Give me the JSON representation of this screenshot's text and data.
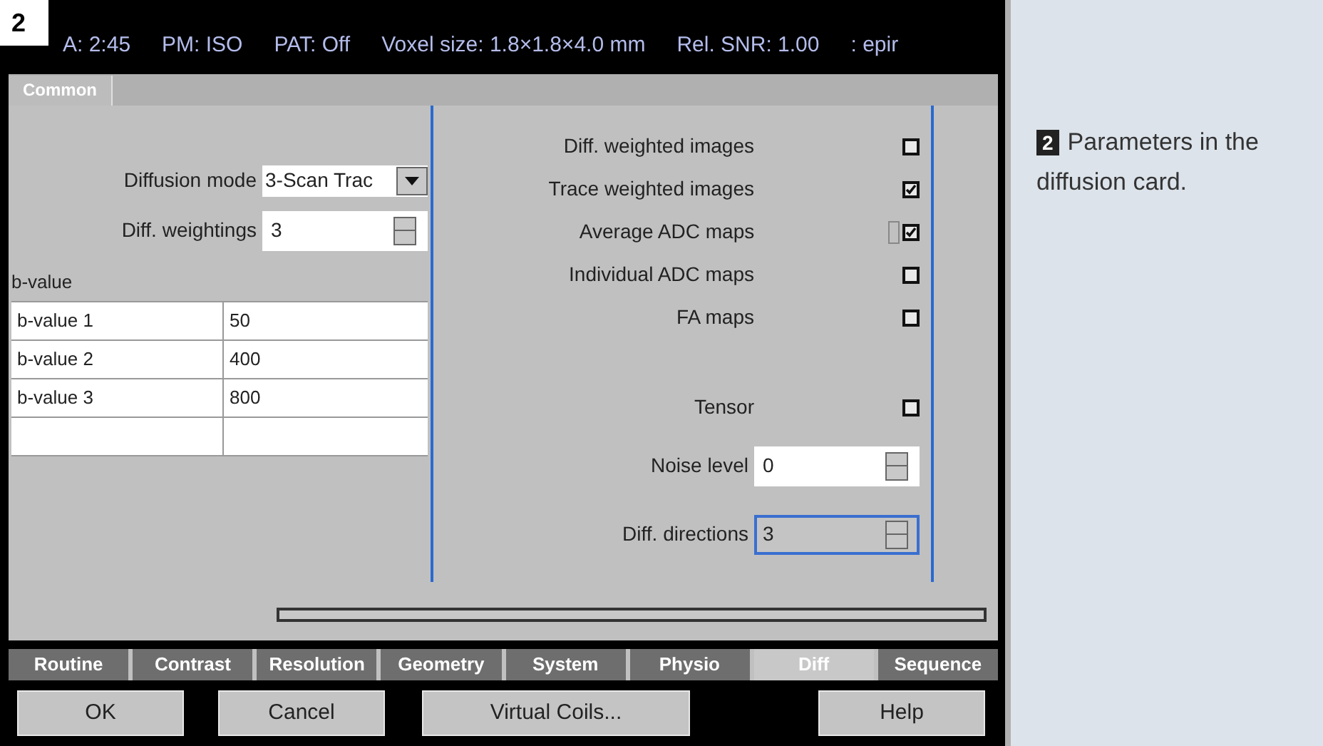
{
  "figure_number": "2",
  "status_bar": [
    "A: 2:45",
    "PM: ISO",
    "PAT: Off",
    "Voxel size: 1.8×1.8×4.0 mm",
    "Rel. SNR: 1.00",
    ": epir"
  ],
  "top_tabs": [
    {
      "label": "Common",
      "selected": true
    }
  ],
  "diffusion_mode": {
    "label": "Diffusion mode",
    "value": "3-Scan Trac"
  },
  "diff_weightings": {
    "label": "Diff. weightings",
    "value": "3"
  },
  "b_value_table": {
    "title": "b-value",
    "rows": [
      [
        "b-value 1",
        "50"
      ],
      [
        "b-value 2",
        "400"
      ],
      [
        "b-value 3",
        "800"
      ],
      [
        "",
        ""
      ]
    ]
  },
  "options": [
    {
      "label": "Diff. weighted images",
      "checked": false
    },
    {
      "label": "Trace weighted images",
      "checked": true
    },
    {
      "label": "Average ADC maps",
      "checked": true
    },
    {
      "label": "Individual ADC maps",
      "checked": false
    },
    {
      "label": "FA maps",
      "checked": false
    },
    {
      "label": "Tensor",
      "checked": false
    }
  ],
  "noise_level": {
    "label": "Noise level",
    "value": "0",
    "focused": false
  },
  "diff_directions": {
    "label": "Diff. directions",
    "value": "3",
    "focused": true
  },
  "card_tabs": [
    {
      "label": "Routine",
      "selected": false
    },
    {
      "label": "Contrast",
      "selected": false
    },
    {
      "label": "Resolution",
      "selected": false
    },
    {
      "label": "Geometry",
      "selected": false
    },
    {
      "label": "System",
      "selected": false
    },
    {
      "label": "Physio",
      "selected": false
    },
    {
      "label": "Diff",
      "selected": true
    },
    {
      "label": "Sequence",
      "selected": false
    }
  ],
  "buttons": [
    "OK",
    "Cancel",
    "Virtual Coils...",
    "Help"
  ],
  "caption": {
    "number": "2",
    "text": "Parameters in the diffusion card."
  }
}
